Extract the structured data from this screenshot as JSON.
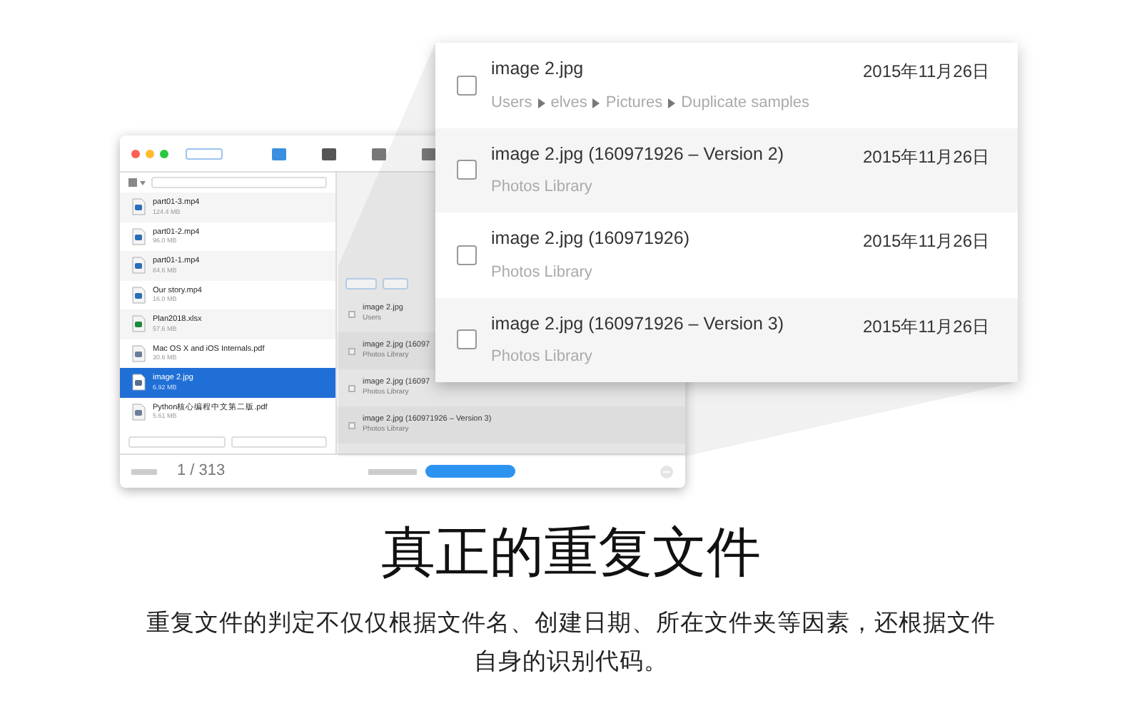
{
  "mini_window": {
    "files": [
      {
        "name": "part01-3.mp4",
        "size": "124.4 MB",
        "kind": "video",
        "selected": false
      },
      {
        "name": "part01-2.mp4",
        "size": "96.0 MB",
        "kind": "video",
        "selected": false
      },
      {
        "name": "part01-1.mp4",
        "size": "84.6 MB",
        "kind": "video",
        "selected": false
      },
      {
        "name": "Our story.mp4",
        "size": "16.0 MB",
        "kind": "video",
        "selected": false
      },
      {
        "name": "Plan2018.xlsx",
        "size": "57.6 MB",
        "kind": "sheet",
        "selected": false
      },
      {
        "name": "Mac OS X and iOS Internals.pdf",
        "size": "30.6 MB",
        "kind": "pdf",
        "selected": false
      },
      {
        "name": "image 2.jpg",
        "size": "6.92 MB",
        "kind": "image",
        "selected": true
      },
      {
        "name": "Python核心编程中文第二版.pdf",
        "size": "5.61 MB",
        "kind": "pdf",
        "selected": false
      }
    ],
    "results": [
      {
        "title": "image 2.jpg",
        "subtitle": "Users",
        "checked": false
      },
      {
        "title": "image 2.jpg  (16097",
        "subtitle": "Photos Library",
        "checked": false
      },
      {
        "title": "image 2.jpg  (16097",
        "subtitle": "Photos Library",
        "checked": false
      },
      {
        "title": "image 2.jpg  (160971926 – Version 3)",
        "subtitle": "Photos Library",
        "checked": false
      }
    ],
    "counter": "1 / 313"
  },
  "callout": {
    "rows": [
      {
        "title": "image 2.jpg",
        "path": [
          "Users",
          "elves",
          "Pictures",
          "Duplicate samples"
        ],
        "date": "2015年11月26日",
        "checked": false
      },
      {
        "title": "image 2.jpg  (160971926 – Version 2)",
        "location": "Photos Library",
        "date": "2015年11月26日",
        "checked": false
      },
      {
        "title": "image 2.jpg  (160971926)",
        "location": "Photos Library",
        "date": "2015年11月26日",
        "checked": false
      },
      {
        "title": "image 2.jpg  (160971926 – Version 3)",
        "location": "Photos Library",
        "date": "2015年11月26日",
        "checked": false
      }
    ]
  },
  "headline": "真正的重复文件",
  "description": [
    "重复文件的判定不仅仅根据文件名、创建日期、所在文件夹等因素，还根据文件",
    "自身的识别代码。"
  ]
}
